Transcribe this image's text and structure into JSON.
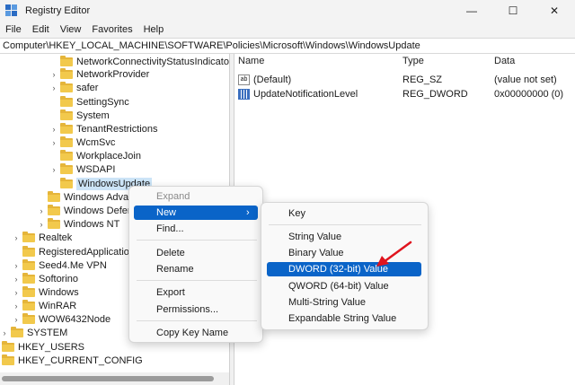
{
  "window": {
    "title": "Registry Editor",
    "minimize": "—",
    "maximize": "☐",
    "close": "✕"
  },
  "menubar": [
    "File",
    "Edit",
    "View",
    "Favorites",
    "Help"
  ],
  "address": "Computer\\HKEY_LOCAL_MACHINE\\SOFTWARE\\Policies\\Microsoft\\Windows\\WindowsUpdate",
  "tree": [
    {
      "label": "NetworkConnectivityStatusIndicator",
      "expander": false
    },
    {
      "label": "NetworkProvider",
      "expander": true
    },
    {
      "label": "safer",
      "expander": true
    },
    {
      "label": "SettingSync",
      "expander": false
    },
    {
      "label": "System",
      "expander": false
    },
    {
      "label": "TenantRestrictions",
      "expander": true
    },
    {
      "label": "WcmSvc",
      "expander": true
    },
    {
      "label": "WorkplaceJoin",
      "expander": false
    },
    {
      "label": "WSDAPI",
      "expander": true
    },
    {
      "label": "WindowsUpdate",
      "expander": false,
      "selected": true
    },
    {
      "label": "Windows Advanced Threat Protection",
      "expander": false
    },
    {
      "label": "Windows Defender",
      "expander": true
    },
    {
      "label": "Windows NT",
      "expander": true
    },
    {
      "label": "Realtek",
      "expander": true
    },
    {
      "label": "RegisteredApplications",
      "expander": false
    },
    {
      "label": "Seed4.Me VPN",
      "expander": true
    },
    {
      "label": "Softorino",
      "expander": true
    },
    {
      "label": "Windows",
      "expander": true
    },
    {
      "label": "WinRAR",
      "expander": true
    },
    {
      "label": "WOW6432Node",
      "expander": true
    },
    {
      "label": "SYSTEM",
      "expander": true
    },
    {
      "label": "HKEY_USERS",
      "expander": true
    },
    {
      "label": "HKEY_CURRENT_CONFIG",
      "expander": true
    }
  ],
  "list": {
    "headers": {
      "name": "Name",
      "type": "Type",
      "data": "Data"
    },
    "rows": [
      {
        "name": "(Default)",
        "type": "REG_SZ",
        "data": "(value not set)",
        "icon": "ab-string-icon"
      },
      {
        "name": "UpdateNotificationLevel",
        "type": "REG_DWORD",
        "data": "0x00000000 (0)",
        "icon": "binary-value-icon"
      }
    ]
  },
  "context_menu": {
    "expand": "Expand",
    "new": "New",
    "find": "Find...",
    "delete": "Delete",
    "rename": "Rename",
    "export": "Export",
    "permissions": "Permissions...",
    "copy_key_name": "Copy Key Name",
    "arrow": "›"
  },
  "submenu": {
    "items": [
      "Key",
      "String Value",
      "Binary Value",
      "DWORD (32-bit) Value",
      "QWORD (64-bit) Value",
      "Multi-String Value",
      "Expandable String Value"
    ]
  },
  "colors": {
    "highlight": "#0a64c8",
    "selection": "#cce4f7",
    "annotation_arrow": "#e0141e"
  }
}
